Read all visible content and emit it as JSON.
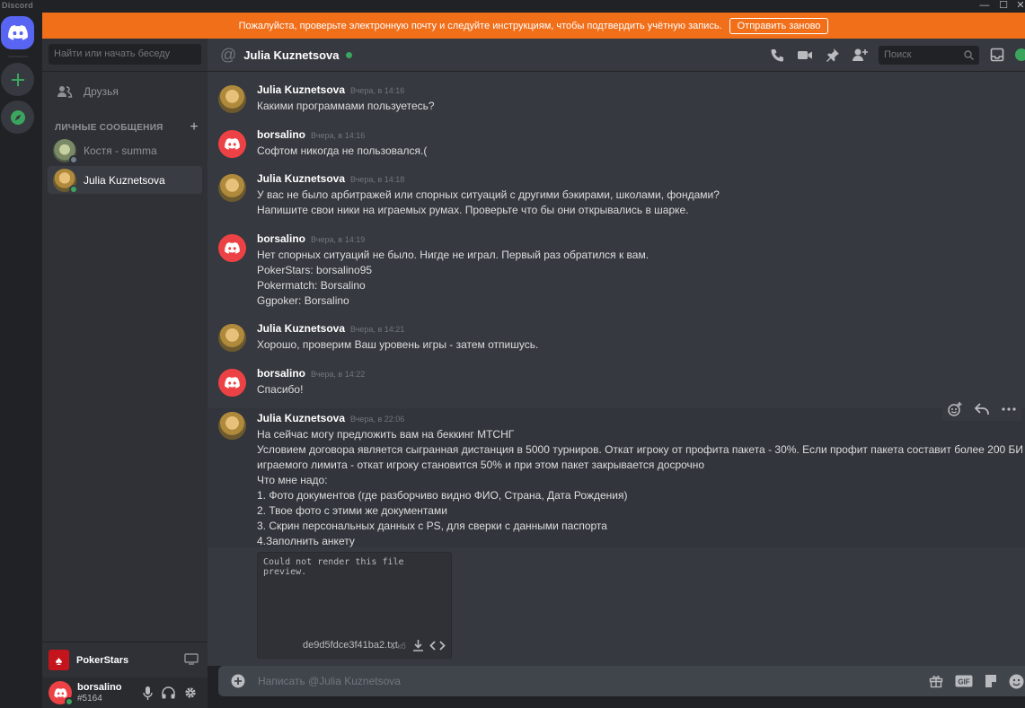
{
  "app": {
    "title": "Discord"
  },
  "banner": {
    "text": "Пожалуйста, проверьте электронную почту и следуйте инструкциям, чтобы подтвердить учётную запись.",
    "button": "Отправить заново"
  },
  "sidebar": {
    "search_placeholder": "Найти или начать беседу",
    "friends_label": "Друзья",
    "dm_header": "ЛИЧНЫЕ СООБЩЕНИЯ",
    "dms": [
      {
        "name": "Костя - summa",
        "status_color": "#747f8d"
      },
      {
        "name": "Julia Kuznetsova",
        "status_color": "#3ba55d"
      }
    ],
    "activity": "PokerStars",
    "user": {
      "name": "borsalino",
      "tag": "#5164"
    }
  },
  "header": {
    "channel": "Julia Kuznetsova",
    "search_placeholder": "Поиск"
  },
  "messages": [
    {
      "author": "Julia Kuznetsova",
      "time": "Вчера, в 14:16",
      "lines": [
        "Какими программами пользуетесь?"
      ]
    },
    {
      "author": "borsalino",
      "time": "Вчера, в 14:16",
      "lines": [
        "Софтом никогда не пользовался.("
      ]
    },
    {
      "author": "Julia Kuznetsova",
      "time": "Вчера, в 14:18",
      "lines": [
        "У вас не было арбитражей или спорных ситуаций с другими бэкирами, школами, фондами?",
        "Напишите свои ники на играемых румах. Проверьте что бы они открывались в шарке."
      ]
    },
    {
      "author": "borsalino",
      "time": "Вчера, в 14:19",
      "lines": [
        "Нет спорных ситуаций не было. Нигде не играл. Первый раз обратился к вам.",
        "PokerStars: borsalino95",
        "Pokermatch: Borsalino",
        "Ggpoker: Borsalino"
      ]
    },
    {
      "author": "Julia Kuznetsova",
      "time": "Вчера, в 14:21",
      "lines": [
        "Хорошо, проверим Ваш уровень игры - затем отпишусь."
      ]
    },
    {
      "author": "borsalino",
      "time": "Вчера, в 14:22",
      "lines": [
        "Спасибо!"
      ]
    },
    {
      "author": "Julia Kuznetsova",
      "time": "Вчера, в 22:06",
      "lines": [
        "На сейчас могу предложить вам на беккинг МТСНГ",
        "Условием договора является сыгранная дистанция в 5000 турниров. Откат игроку от профита пакета - 30%. Если профит пакета составит более 200 БИ",
        "играемого лимита - откат игроку становится 50% и при этом пакет закрывается досрочно",
        "Что мне надо:",
        "1. Фото документов (где разборчиво видно ФИО, Страна, Дата Рождения)",
        "2. Твое фото с этими же документами",
        "3. Скрин персональных данных с PS, для сверки с данными паспорта",
        "4.Заполнить анкету"
      ]
    }
  ],
  "attachment": {
    "preview_text": "Could not render this file preview.",
    "filename": "de9d5fdce3f41ba2.txt",
    "size": "1 кб"
  },
  "composer": {
    "placeholder": "Написать @Julia Kuznetsova"
  }
}
